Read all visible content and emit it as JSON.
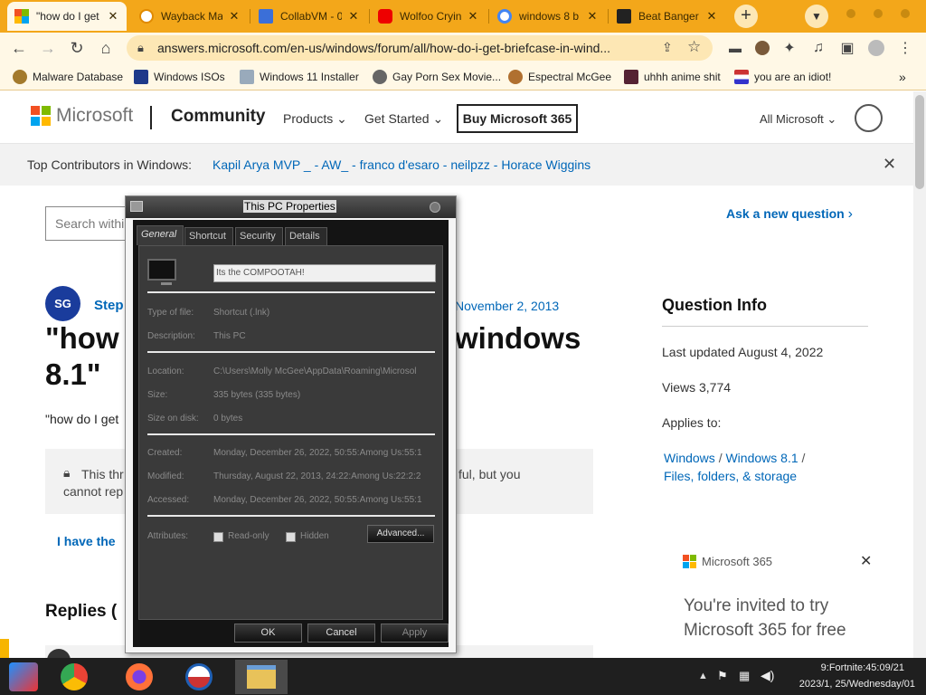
{
  "browser": {
    "tabs": [
      {
        "title": "\"how do I get",
        "icon": "microsoft-icon",
        "active": true
      },
      {
        "title": "Wayback Ma",
        "icon": "wayback-icon"
      },
      {
        "title": "CollabVM - 0",
        "icon": "document-icon"
      },
      {
        "title": "Wolfoo Cryin",
        "icon": "youtube-icon"
      },
      {
        "title": "windows 8 b",
        "icon": "google-icon"
      },
      {
        "title": "Beat Banger",
        "icon": "beat-banger-icon"
      }
    ],
    "new_tab_label": "+",
    "address": "answers.microsoft.com/en-us/windows/forum/all/how-do-i-get-briefcase-in-wind...",
    "bookmarks": [
      {
        "label": "Malware Database"
      },
      {
        "label": "Windows ISOs"
      },
      {
        "label": "Windows 11 Installer"
      },
      {
        "label": "Gay Porn Sex Movie..."
      },
      {
        "label": "Espectral McGee"
      },
      {
        "label": "uhhh anime shit"
      },
      {
        "label": "you are an idiot!"
      }
    ],
    "bookmarks_overflow": "»"
  },
  "page": {
    "brand": "Microsoft",
    "community": "Community",
    "nav": [
      "Products",
      "Get Started"
    ],
    "buy_button": "Buy Microsoft 365",
    "all_microsoft": "All Microsoft",
    "contributors_label": "Top Contributors in Windows:",
    "contributors": "Kapil Arya MVP _ - AW_  - franco d'esaro - neilpzz - Horace Wiggins",
    "search_placeholder": "Search withi",
    "ask_question": "Ask a new question",
    "avatar_initials": "SG",
    "author_partial": "Step",
    "date_partial": "November 2, 2013",
    "title_line1_left": "\"how",
    "title_line1_right": "windows",
    "title_line2": "8.1\"",
    "body_partial": "\"how do I get",
    "locked_partial": "This thr",
    "locked_right": "ful, but you",
    "locked_line2": "cannot rep",
    "have_same": "I have the",
    "replies_partial": "Replies (",
    "question_info": {
      "heading": "Question Info",
      "last_updated": "Last updated August 4, 2022",
      "views": "Views 3,774",
      "applies_to": "Applies to:",
      "crumb1": "Windows",
      "crumb_sep": "/",
      "crumb2": "Windows 8.1",
      "crumb3": "Files, folders, & storage"
    },
    "promo": {
      "brand": "Microsoft 365",
      "line1": "You're invited to try",
      "line2": "Microsoft 365 for free"
    }
  },
  "dialog": {
    "title": "This PC Properties",
    "tabs": [
      "General",
      "Shortcut",
      "Security",
      "Details"
    ],
    "name_value": "Its the COMPOOTAH!",
    "rows1": [
      {
        "label": "Type of file:",
        "value": "Shortcut (.lnk)"
      },
      {
        "label": "Description:",
        "value": "This PC"
      }
    ],
    "rows2": [
      {
        "label": "Location:",
        "value": "C:\\Users\\Molly McGee\\AppData\\Roaming\\Microsol"
      },
      {
        "label": "Size:",
        "value": "335 bytes (335 bytes)"
      },
      {
        "label": "Size on disk:",
        "value": "0 bytes"
      }
    ],
    "rows3": [
      {
        "label": "Created:",
        "value": "Monday, December 26, 2022, 50:55:Among Us:55:1"
      },
      {
        "label": "Modified:",
        "value": "Thursday, August 22, 2013, 24:22:Among Us:22:2:2"
      },
      {
        "label": "Accessed:",
        "value": "Monday, December 26, 2022, 50:55:Among Us:55:1"
      }
    ],
    "attributes_label": "Attributes:",
    "readonly_label": "Read-only",
    "hidden_label": "Hidden",
    "advanced_button": "Advanced...",
    "ok": "OK",
    "cancel": "Cancel",
    "apply": "Apply"
  },
  "taskbar": {
    "clock_line1": "9:Fortnite:45:09/21",
    "clock_line2": "2023/1, 25/Wednesday/01"
  },
  "colors": {
    "chrome_frame": "#f3a71a",
    "toolbar_bg": "#fff8e6",
    "ms_blue": "#0067b8",
    "dialog_bg": "#3a3a3a"
  }
}
